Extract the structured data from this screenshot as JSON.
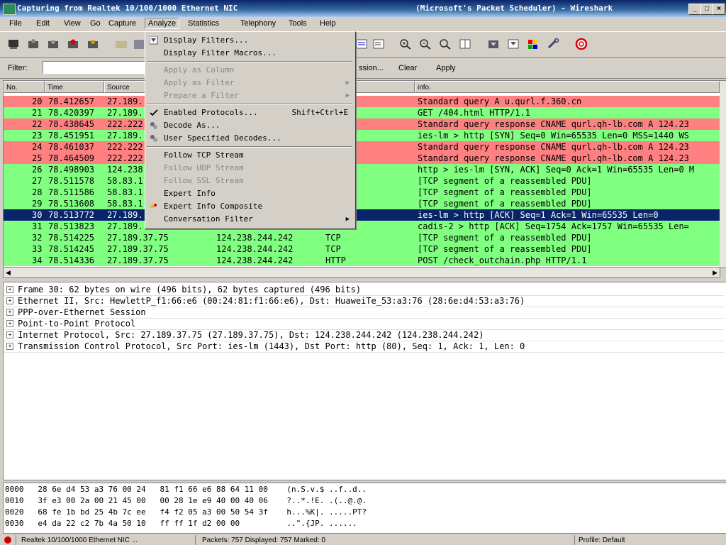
{
  "title": {
    "left": "Capturing from Realtek 10/100/1000 Ethernet NIC",
    "right": "(Microsoft's Packet Scheduler) - Wireshark"
  },
  "window_buttons": {
    "minimize": "_",
    "maximize": "□",
    "close": "×"
  },
  "menu": {
    "items": [
      "File",
      "Edit",
      "View",
      "Go",
      "Capture",
      "Analyze",
      "Statistics",
      "Telephony",
      "Tools",
      "Help"
    ]
  },
  "filter": {
    "label": "Filter:",
    "value": "",
    "expression": "ssion...",
    "clear": "Clear",
    "apply": "Apply"
  },
  "packet_list": {
    "columns": [
      "No.",
      "Time",
      "Source",
      "",
      "",
      "info."
    ],
    "rows": [
      {
        "no": "20",
        "time": "78.412657",
        "src": "27.189.",
        "dst": "",
        "proto": "",
        "info": "Standard query A u.qurl.f.360.cn",
        "color": "#ff8080"
      },
      {
        "no": "21",
        "time": "78.420397",
        "src": "27.189.",
        "dst": "",
        "proto": "",
        "info": "GET /404.html HTTP/1.1",
        "color": "#80ff80"
      },
      {
        "no": "22",
        "time": "78.438645",
        "src": "222.222",
        "dst": "",
        "proto": "",
        "info": "Standard query response CNAME qurl.qh-lb.com A 124.23",
        "color": "#ff8080"
      },
      {
        "no": "23",
        "time": "78.451951",
        "src": "27.189.",
        "dst": "",
        "proto": "",
        "info": "ies-lm > http [SYN] Seq=0 Win=65535 Len=0 MSS=1440 WS",
        "color": "#80ff80"
      },
      {
        "no": "24",
        "time": "78.461037",
        "src": "222.222",
        "dst": "",
        "proto": "",
        "info": "Standard query response CNAME qurl.qh-lb.com A 124.23",
        "color": "#ff8080"
      },
      {
        "no": "25",
        "time": "78.464509",
        "src": "222.222",
        "dst": "",
        "proto": "",
        "info": "Standard query response CNAME qurl.qh-lb.com A 124.23",
        "color": "#ff8080"
      },
      {
        "no": "26",
        "time": "78.498903",
        "src": "124.238",
        "dst": "",
        "proto": "",
        "info": "http > ies-lm [SYN, ACK] Seq=0 Ack=1 Win=65535 Len=0 M",
        "color": "#80ff80"
      },
      {
        "no": "27",
        "time": "78.511578",
        "src": "58.83.1",
        "dst": "",
        "proto": "",
        "info": "[TCP segment of a reassembled PDU]",
        "color": "#80ff80"
      },
      {
        "no": "28",
        "time": "78.511586",
        "src": "58.83.1",
        "dst": "",
        "proto": "",
        "info": "[TCP segment of a reassembled PDU]",
        "color": "#80ff80"
      },
      {
        "no": "29",
        "time": "78.513608",
        "src": "58.83.1",
        "dst": "",
        "proto": "",
        "info": "[TCP segment of a reassembled PDU]",
        "color": "#80ff80"
      },
      {
        "no": "30",
        "time": "78.513772",
        "src": "27.189.",
        "dst": "",
        "proto": "",
        "info": "ies-lm > http [ACK] Seq=1 Ack=1 Win=65535 Len=0",
        "color": "#0a246a",
        "selected": true
      },
      {
        "no": "31",
        "time": "78.513823",
        "src": "27.189.",
        "dst": "",
        "proto": "",
        "info": "cadis-2 > http [ACK] Seq=1754 Ack=1757 Win=65535 Len=",
        "color": "#80ff80"
      },
      {
        "no": "32",
        "time": "78.514225",
        "src": "27.189.37.75",
        "dst": "124.238.244.242",
        "proto": "TCP",
        "info": "[TCP segment of a reassembled PDU]",
        "color": "#80ff80"
      },
      {
        "no": "33",
        "time": "78.514245",
        "src": "27.189.37.75",
        "dst": "124.238.244.242",
        "proto": "TCP",
        "info": "[TCP segment of a reassembled PDU]",
        "color": "#80ff80"
      },
      {
        "no": "34",
        "time": "78.514336",
        "src": "27.189.37.75",
        "dst": "124.238.244.242",
        "proto": "HTTP",
        "info": "POST /check_outchain.php HTTP/1.1",
        "color": "#80ff80"
      }
    ]
  },
  "details": [
    "Frame 30: 62 bytes on wire (496 bits), 62 bytes captured (496 bits)",
    "Ethernet II, Src: HewlettP_f1:66:e6 (00:24:81:f1:66:e6), Dst: HuaweiTe_53:a3:76 (28:6e:d4:53:a3:76)",
    "PPP-over-Ethernet Session",
    "Point-to-Point Protocol",
    "Internet Protocol, Src: 27.189.37.75 (27.189.37.75), Dst: 124.238.244.242 (124.238.244.242)",
    "Transmission Control Protocol, Src Port: ies-lm (1443), Dst Port: http (80), Seq: 1, Ack: 1, Len: 0"
  ],
  "bytes": [
    "0000   28 6e d4 53 a3 76 00 24   81 f1 66 e6 88 64 11 00    (n.S.v.$ ..f..d..",
    "0010   3f e3 00 2a 00 21 45 00   00 28 1e e9 40 00 40 06    ?..*.!E. .(..@.@.",
    "0020   68 fe 1b bd 25 4b 7c ee   f4 f2 05 a3 00 50 54 3f    h...%K|. .....PT?",
    "0030   e4 da 22 c2 7b 4a 50 10   ff ff 1f d2 00 00          ..\".{JP. ......"
  ],
  "status": {
    "interface": "Realtek 10/100/1000 Ethernet NIC ...",
    "packets": "Packets: 757 Displayed: 757 Marked: 0",
    "profile": "Profile: Default"
  },
  "analyze_menu": [
    {
      "label": "Display Filters...",
      "shortcut": "",
      "icon": "filter-icon",
      "disabled": false
    },
    {
      "label": "Display Filter Macros...",
      "shortcut": "",
      "icon": "",
      "disabled": false
    },
    {
      "sep": true
    },
    {
      "label": "Apply as Column",
      "shortcut": "",
      "icon": "",
      "disabled": true
    },
    {
      "label": "Apply as Filter",
      "shortcut": "",
      "icon": "",
      "disabled": true,
      "submenu": true
    },
    {
      "label": "Prepare a Filter",
      "shortcut": "",
      "icon": "",
      "disabled": true,
      "submenu": true
    },
    {
      "sep": true
    },
    {
      "label": "Enabled Protocols...",
      "shortcut": "Shift+Ctrl+E",
      "icon": "check-icon",
      "disabled": false
    },
    {
      "label": "Decode As...",
      "shortcut": "",
      "icon": "decode-icon",
      "disabled": false
    },
    {
      "label": "User Specified Decodes...",
      "shortcut": "",
      "icon": "decode-icon",
      "disabled": false
    },
    {
      "sep": true
    },
    {
      "label": "Follow TCP Stream",
      "shortcut": "",
      "icon": "",
      "disabled": false
    },
    {
      "label": "Follow UDP Stream",
      "shortcut": "",
      "icon": "",
      "disabled": true
    },
    {
      "label": "Follow SSL Stream",
      "shortcut": "",
      "icon": "",
      "disabled": true
    },
    {
      "label": "Expert Info",
      "shortcut": "",
      "icon": "",
      "disabled": false
    },
    {
      "label": "Expert Info Composite",
      "shortcut": "",
      "icon": "expert-icon",
      "disabled": false
    },
    {
      "label": "Conversation Filter",
      "shortcut": "",
      "icon": "",
      "disabled": false,
      "submenu": true
    }
  ]
}
